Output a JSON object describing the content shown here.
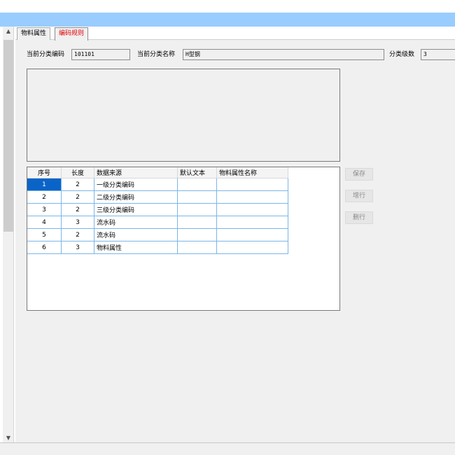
{
  "tabs": [
    {
      "label": "物料属性"
    },
    {
      "label": "编码规则"
    }
  ],
  "form": {
    "code_label": "当前分类编码",
    "code_value": "101101",
    "name_label": "当前分类名称",
    "name_value": "H型钢",
    "level_label": "分类级数",
    "level_value": "3"
  },
  "grid": {
    "columns": [
      "序号",
      "长度",
      "数据来源",
      "默认文本",
      "物料属性名称"
    ],
    "rows": [
      {
        "no": "1",
        "len": "2",
        "source": "一级分类编码",
        "default": "",
        "attr": ""
      },
      {
        "no": "2",
        "len": "2",
        "source": "二级分类编码",
        "default": "",
        "attr": ""
      },
      {
        "no": "3",
        "len": "2",
        "source": "三级分类编码",
        "default": "",
        "attr": ""
      },
      {
        "no": "4",
        "len": "3",
        "source": "流水码",
        "default": "",
        "attr": ""
      },
      {
        "no": "5",
        "len": "2",
        "source": "流水码",
        "default": "",
        "attr": ""
      },
      {
        "no": "6",
        "len": "3",
        "source": "物料属性",
        "default": "",
        "attr": ""
      }
    ],
    "selected_row": 0
  },
  "buttons": {
    "save": "保存",
    "add_row": "增行",
    "delete_row": "删行"
  },
  "icons": {
    "scroll_up": "chevron-up-icon",
    "scroll_down": "chevron-down-icon"
  },
  "colors": {
    "titlebar": "#99ccff",
    "active_tab_text": "#e00000",
    "selection": "#0a64c8",
    "grid_line": "#7ab6e8"
  }
}
